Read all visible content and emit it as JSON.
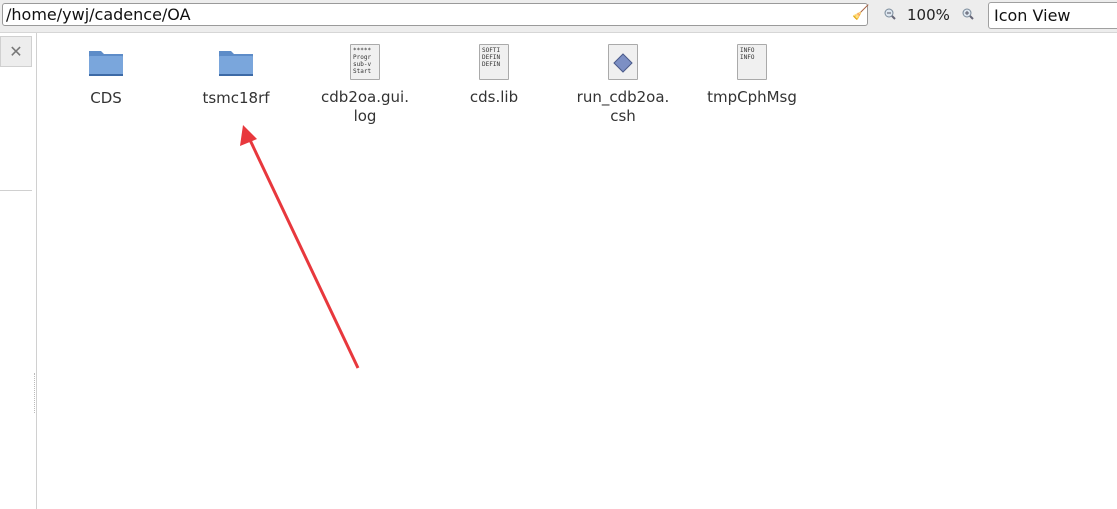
{
  "toolbar": {
    "location": "/home/ywj/cadence/OA",
    "zoom_level": "100%",
    "view_mode": "Icon View"
  },
  "sidebar": {
    "close_label": "✕"
  },
  "files": [
    {
      "name": "CDS",
      "type": "folder"
    },
    {
      "name": "tsmc18rf",
      "type": "folder"
    },
    {
      "name": "cdb2oa.gui.\nlog",
      "type": "text",
      "preview": "*****\nProgr\nsub-v\nStart"
    },
    {
      "name": "cds.lib",
      "type": "text",
      "preview": "SOFTI\nDEFIN\nDEFIN"
    },
    {
      "name": "run_cdb2oa.\ncsh",
      "type": "script"
    },
    {
      "name": "tmpCphMsg",
      "type": "text",
      "preview": "INFO\nINFO"
    }
  ],
  "annotation": {
    "arrow_color": "#e8383d",
    "folder_color": "#6f9bd3"
  }
}
